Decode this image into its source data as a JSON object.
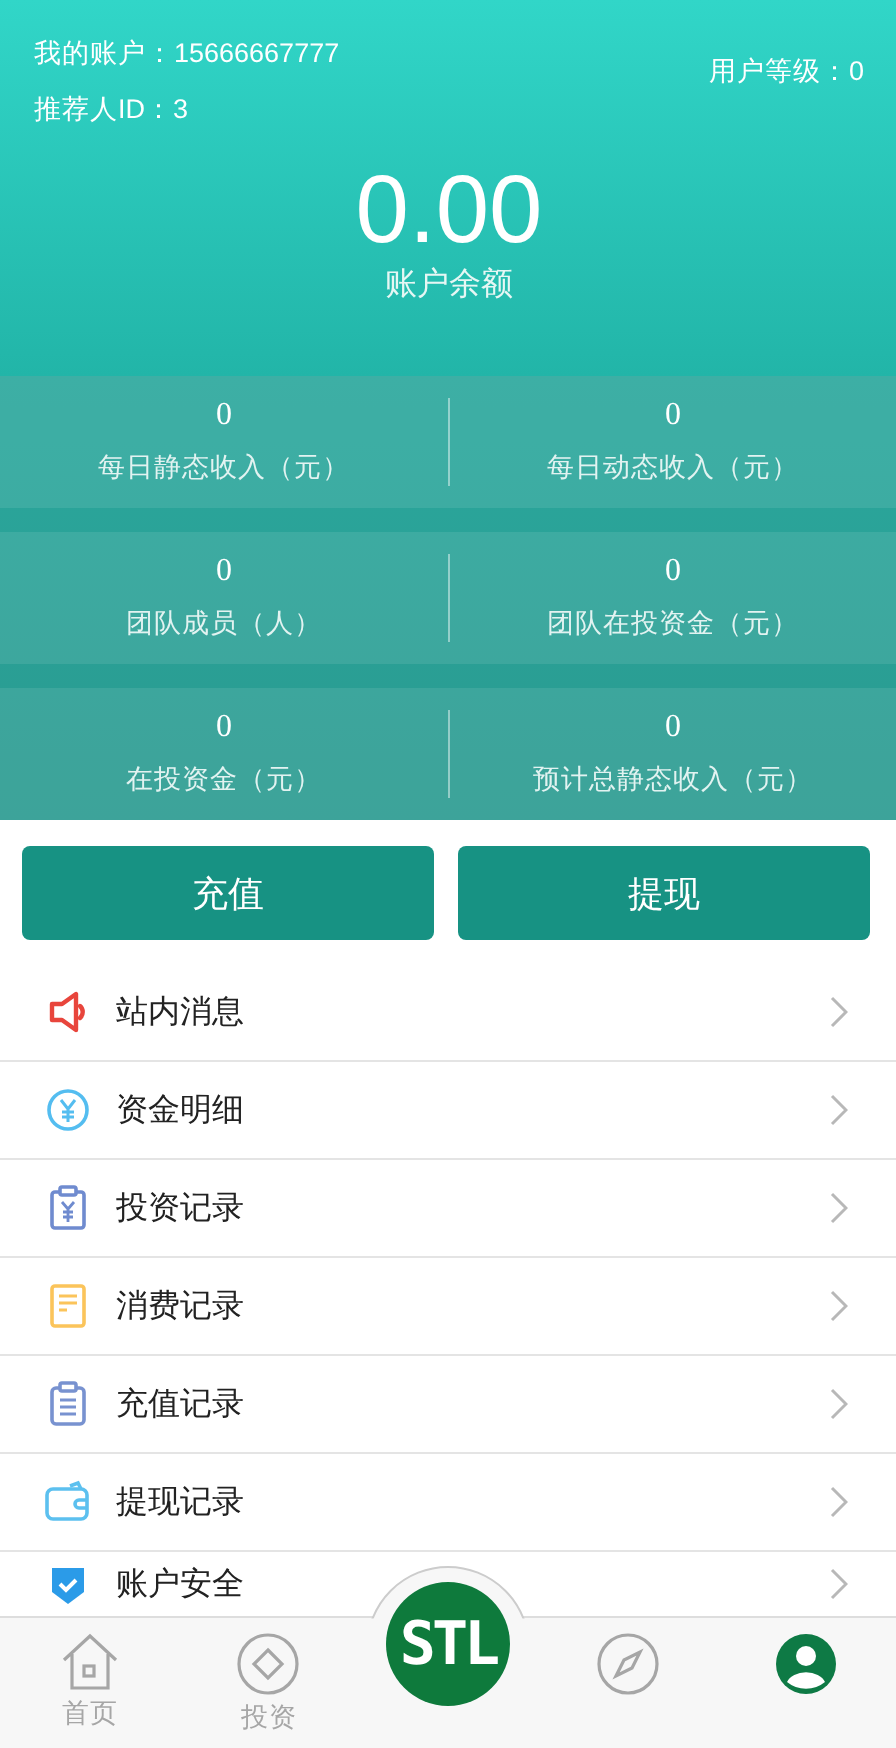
{
  "header": {
    "account_label": "我的账户：15666667777",
    "referrer_label": "推荐人ID：3",
    "level_label": "用户等级：0",
    "balance": "0.00",
    "balance_label": "账户余额"
  },
  "stats": [
    {
      "value": "0",
      "label": "每日静态收入（元）"
    },
    {
      "value": "0",
      "label": "每日动态收入（元）"
    },
    {
      "value": "0",
      "label": "团队成员（人）"
    },
    {
      "value": "0",
      "label": "团队在投资金（元）"
    },
    {
      "value": "0",
      "label": "在投资金（元）"
    },
    {
      "value": "0",
      "label": "预计总静态收入（元）"
    }
  ],
  "buttons": [
    "充值",
    "提现"
  ],
  "menu": [
    "站内消息",
    "资金明细",
    "投资记录",
    "消费记录",
    "充值记录",
    "提现记录",
    "账户安全"
  ],
  "tab_bar": [
    {
      "kind": "home",
      "label": "首页",
      "selected": false
    },
    {
      "kind": "invest",
      "label": "投资",
      "selected": false
    },
    {
      "kind": "logo",
      "label": "STL",
      "selected": false
    },
    {
      "kind": "compass",
      "selected": false
    },
    {
      "kind": "profile",
      "selected": true
    }
  ]
}
